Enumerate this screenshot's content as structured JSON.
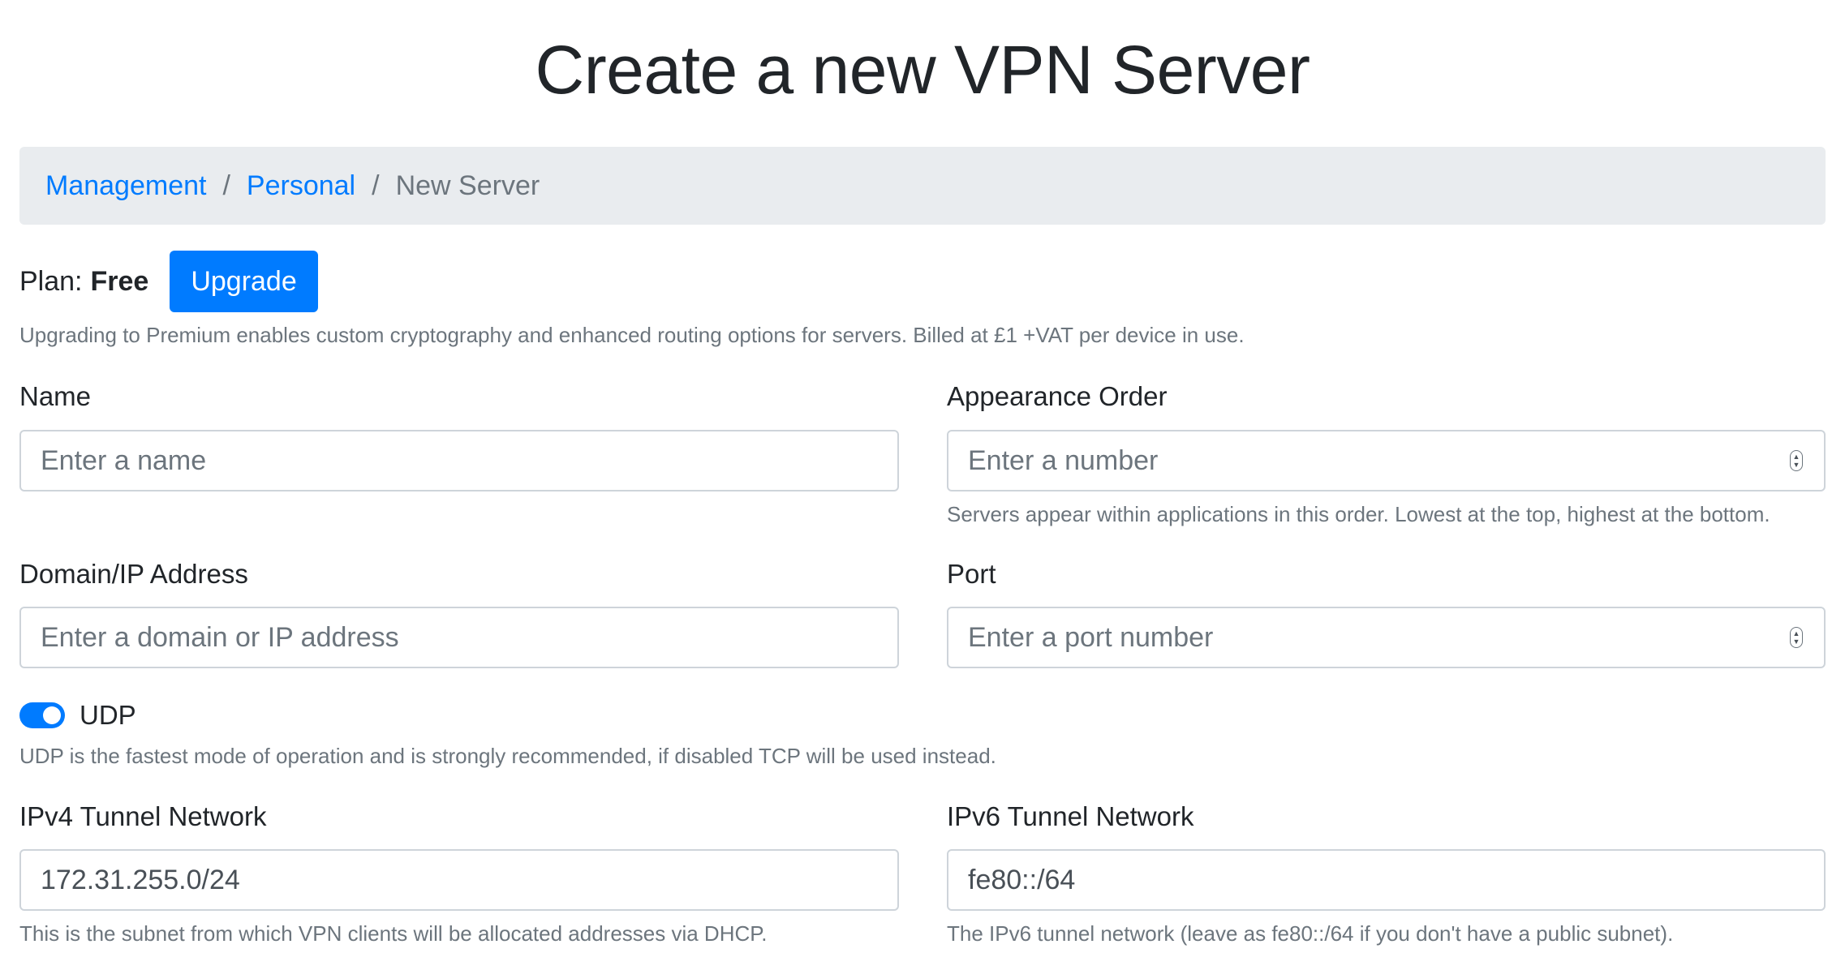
{
  "page": {
    "title": "Create a new VPN Server"
  },
  "breadcrumb": {
    "items": [
      {
        "label": "Management"
      },
      {
        "label": "Personal"
      },
      {
        "label": "New Server"
      }
    ],
    "separator": "/"
  },
  "plan": {
    "label": "Plan:",
    "value": "Free",
    "upgrade_button": "Upgrade",
    "help": "Upgrading to Premium enables custom cryptography and enhanced routing options for servers. Billed at £1 +VAT per device in use."
  },
  "form": {
    "name": {
      "label": "Name",
      "placeholder": "Enter a name",
      "value": ""
    },
    "appearance_order": {
      "label": "Appearance Order",
      "placeholder": "Enter a number",
      "value": "",
      "help": "Servers appear within applications in this order. Lowest at the top, highest at the bottom."
    },
    "domain": {
      "label": "Domain/IP Address",
      "placeholder": "Enter a domain or IP address",
      "value": ""
    },
    "port": {
      "label": "Port",
      "placeholder": "Enter a port number",
      "value": ""
    },
    "udp": {
      "label": "UDP",
      "enabled": true,
      "help": "UDP is the fastest mode of operation and is strongly recommended, if disabled TCP will be used instead."
    },
    "ipv4": {
      "label": "IPv4 Tunnel Network",
      "value": "172.31.255.0/24",
      "help": "This is the subnet from which VPN clients will be allocated addresses via DHCP."
    },
    "ipv6": {
      "label": "IPv6 Tunnel Network",
      "value": "fe80::/64",
      "help": "The IPv6 tunnel network (leave as fe80::/64 if you don't have a public subnet)."
    }
  },
  "colors": {
    "primary": "#007bff",
    "muted": "#6c757d",
    "breadcrumb_bg": "#e9ecef",
    "border": "#ced4da"
  },
  "icons": {
    "spinner": "number-spinner-icon",
    "toggle": "toggle-switch-icon"
  }
}
